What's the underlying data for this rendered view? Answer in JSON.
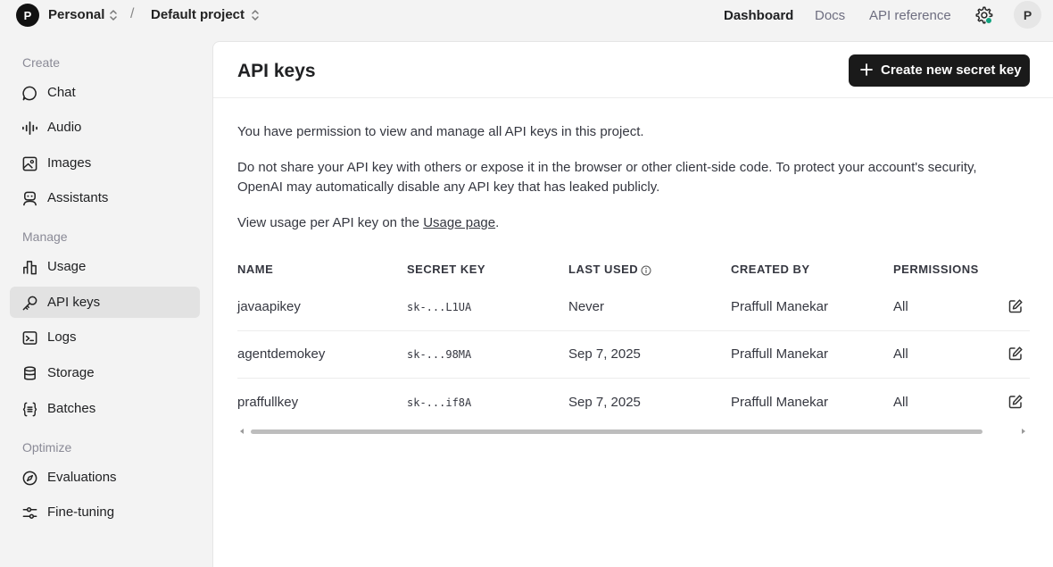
{
  "topbar": {
    "org_initial": "P",
    "org_name": "Personal",
    "separator": "/",
    "project_name": "Default project",
    "nav": {
      "dashboard": "Dashboard",
      "docs": "Docs",
      "api_reference": "API reference"
    },
    "user_initial": "P",
    "status_color": "#10a37f"
  },
  "sidebar": {
    "sections": {
      "create": "Create",
      "manage": "Manage",
      "optimize": "Optimize"
    },
    "items": {
      "chat": {
        "label": "Chat",
        "icon": "chat-bubble-icon"
      },
      "audio": {
        "label": "Audio",
        "icon": "audio-wave-icon"
      },
      "images": {
        "label": "Images",
        "icon": "image-icon"
      },
      "assistants": {
        "label": "Assistants",
        "icon": "robot-icon"
      },
      "usage": {
        "label": "Usage",
        "icon": "bar-chart-icon"
      },
      "api_keys": {
        "label": "API keys",
        "icon": "key-icon",
        "active": true
      },
      "logs": {
        "label": "Logs",
        "icon": "terminal-icon"
      },
      "storage": {
        "label": "Storage",
        "icon": "database-icon"
      },
      "batches": {
        "label": "Batches",
        "icon": "braces-icon"
      },
      "evaluations": {
        "label": "Evaluations",
        "icon": "compass-icon"
      },
      "fine_tuning": {
        "label": "Fine-tuning",
        "icon": "sliders-icon"
      }
    }
  },
  "main": {
    "title": "API keys",
    "create_button": "Create new secret key",
    "permission_text": "You have permission to view and manage all API keys in this project.",
    "warning_text": "Do not share your API key with others or expose it in the browser or other client-side code. To protect your account's security, OpenAI may automatically disable any API key that has leaked publicly.",
    "usage_text_before": "View usage per API key on the ",
    "usage_link": "Usage page",
    "usage_text_after": ".",
    "table": {
      "headers": {
        "name": "NAME",
        "secret_key": "SECRET KEY",
        "last_used": "LAST USED",
        "created_by": "CREATED BY",
        "permissions": "PERMISSIONS"
      },
      "rows": [
        {
          "name": "javaapikey",
          "secret_key": "sk-...L1UA",
          "last_used": "Never",
          "created_by": "Praffull Manekar",
          "permissions": "All"
        },
        {
          "name": "agentdemokey",
          "secret_key": "sk-...98MA",
          "last_used": "Sep 7, 2025",
          "created_by": "Praffull Manekar",
          "permissions": "All"
        },
        {
          "name": "praffullkey",
          "secret_key": "sk-...if8A",
          "last_used": "Sep 7, 2025",
          "created_by": "Praffull Manekar",
          "permissions": "All"
        }
      ]
    }
  }
}
